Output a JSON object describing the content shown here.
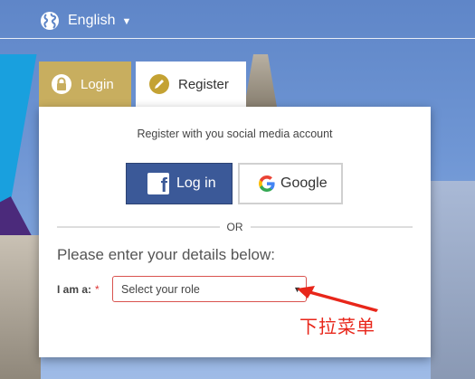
{
  "topbar": {
    "language_label": "English",
    "language_icon": "globe-icon",
    "caret_icon": "caret-down-icon"
  },
  "tabs": [
    {
      "label": "Login",
      "icon": "lock-icon"
    },
    {
      "label": "Register",
      "icon": "pencil-icon"
    }
  ],
  "social": {
    "title": "Register with you social media account",
    "facebook_label": "Log in",
    "google_label": "Google"
  },
  "divider": {
    "or_label": "OR"
  },
  "form": {
    "title": "Please enter your details below:",
    "role_label": "I am a:",
    "required_mark": "*",
    "role_value": "Select your role"
  },
  "annotation": {
    "text": "下拉菜单",
    "color": "#e8261a"
  },
  "colors": {
    "login_tab": "#c8ae5f",
    "register_icon": "#c4a233",
    "facebook": "#3b5998",
    "select_border": "#d9534f"
  }
}
